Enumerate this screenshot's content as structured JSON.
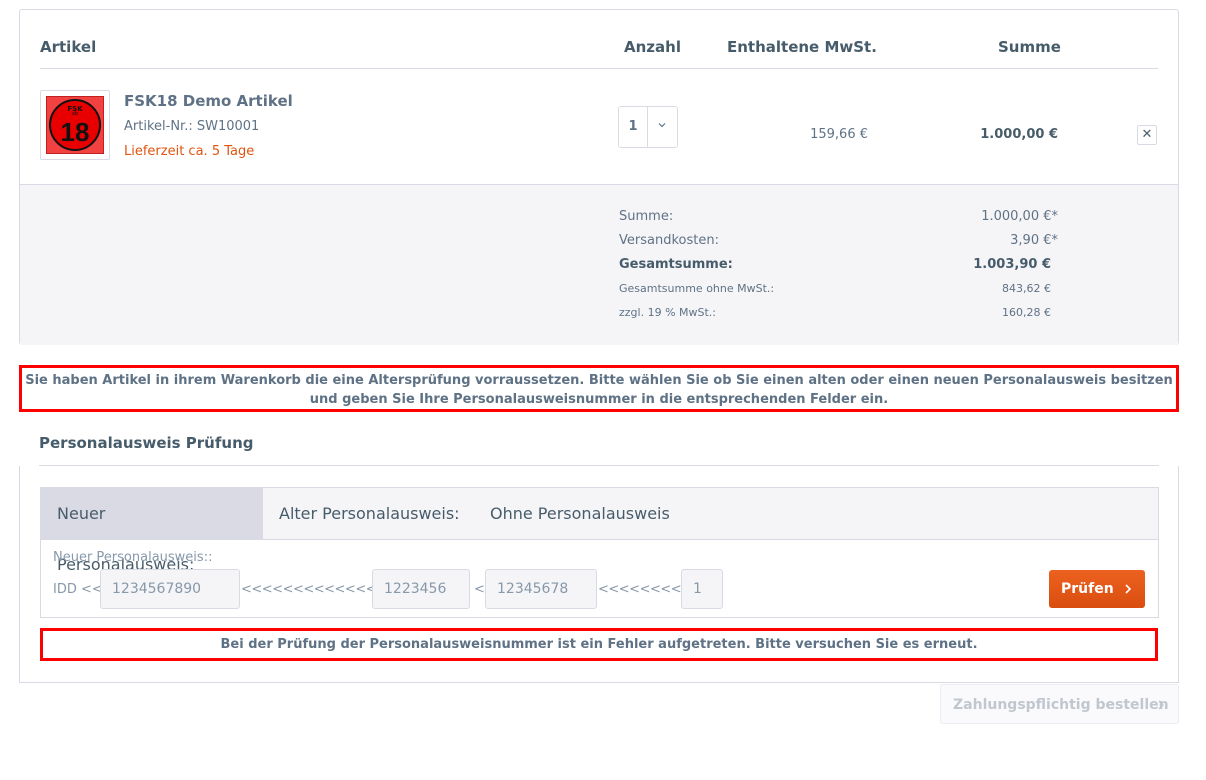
{
  "cart": {
    "columns": {
      "article": "Artikel",
      "quantity": "Anzahl",
      "tax": "Enthaltene MwSt.",
      "sum": "Summe"
    },
    "item": {
      "image": {
        "line1": "FSK",
        "line2": "ab",
        "number": "18"
      },
      "name": "FSK18 Demo Artikel",
      "number": "Artikel-Nr.: SW10001",
      "delivery": "Lieferzeit ca. 5 Tage",
      "quantity": "1",
      "tax": "159,66 €",
      "sum": "1.000,00 €",
      "remove": "✕"
    },
    "totals": [
      {
        "label": "Summe:",
        "value": "1.000,00 €*"
      },
      {
        "label": "Versandkosten:",
        "value": "3,90 €*"
      },
      {
        "label": "Gesamtsumme:",
        "value": "1.003,90 €"
      },
      {
        "label": "Gesamtsumme ohne MwSt.:",
        "value": "843,62 €"
      },
      {
        "label": "zzgl. 19 % MwSt.:",
        "value": "160,28 €"
      }
    ]
  },
  "age_notice": "Sie haben Artikel in ihrem Warenkorb die eine Altersprüfung vorraussetzen. Bitte wählen Sie ob Sie einen alten oder einen neuen Personalausweis besitzen und geben Sie Ihre Personalausweisnummer in die entsprechenden Felder ein.",
  "id_check": {
    "title": "Personalausweis Prüfung",
    "tabs": [
      "Neuer Personalausweis:",
      "Alter Personalausweis:",
      "Ohne Personalausweis"
    ],
    "panel_label": "Neuer Personalausweis::",
    "prefix": "IDD <<",
    "sep1": "<<<<<<<<<<<<<<<<<",
    "sep2": "<",
    "sep3": "<<<<<<<<<<",
    "field1": "1234567890",
    "field2": "1223456",
    "field3": "12345678",
    "field4": "1",
    "check_button": "Prüfen",
    "error": "Bei der Prüfung der Personalausweisnummer ist ein Fehler aufgetreten. Bitte versuchen Sie es erneut."
  },
  "order_button": "Zahlungspflichtig bestellen",
  "colors": {
    "accent": "#e1540f",
    "alert_border": "#ff0000",
    "text": "#52667a"
  }
}
